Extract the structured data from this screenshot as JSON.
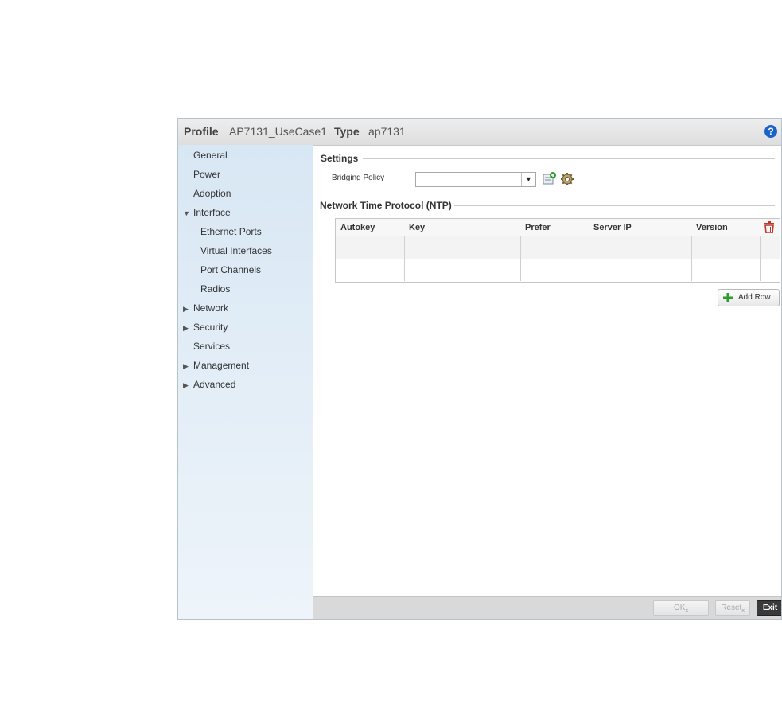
{
  "header": {
    "profile_label": "Profile",
    "profile_value": "AP7131_UseCase1",
    "type_label": "Type",
    "type_value": "ap7131",
    "help_icon": "?"
  },
  "sidebar": {
    "items": [
      {
        "label": "General"
      },
      {
        "label": "Power"
      },
      {
        "label": "Adoption"
      },
      {
        "label": "Interface",
        "expanded": true
      },
      {
        "label": "Ethernet Ports"
      },
      {
        "label": "Virtual Interfaces"
      },
      {
        "label": "Port Channels"
      },
      {
        "label": "Radios"
      },
      {
        "label": "Network",
        "expanded": false
      },
      {
        "label": "Security",
        "expanded": false
      },
      {
        "label": "Services"
      },
      {
        "label": "Management",
        "expanded": false
      },
      {
        "label": "Advanced",
        "expanded": false
      }
    ],
    "arrow_expanded": "▼",
    "arrow_collapsed": "▶"
  },
  "settings": {
    "title": "Settings",
    "bridging_policy_label": "Bridging Policy",
    "bridging_policy_value": ""
  },
  "ntp": {
    "title": "Network Time Protocol (NTP)",
    "columns": [
      "Autokey",
      "Key",
      "Prefer",
      "Server IP",
      "Version"
    ],
    "rows": [
      [
        "",
        "",
        "",
        "",
        ""
      ],
      [
        "",
        "",
        "",
        "",
        ""
      ]
    ],
    "add_row_label": "Add Row"
  },
  "footer": {
    "ok_label": "OK",
    "reset_label": "Reset",
    "exit_label": "Exit"
  },
  "colors": {
    "accent_blue": "#1a63c7",
    "delete_red": "#c0392b",
    "add_green": "#2e9b2e"
  }
}
